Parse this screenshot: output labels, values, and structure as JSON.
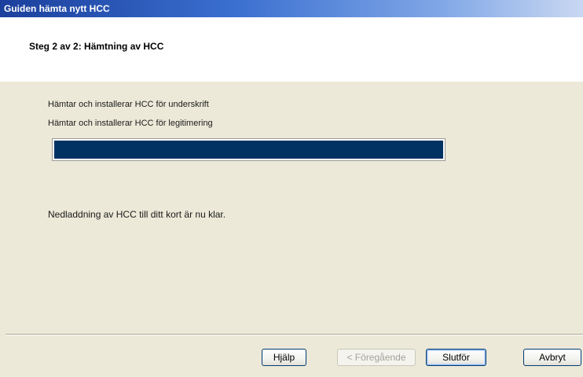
{
  "window": {
    "title": "Guiden hämta nytt HCC"
  },
  "header": {
    "step_title": "Steg 2 av 2: Hämtning av HCC"
  },
  "main": {
    "status_lines": [
      "Hämtar och installerar HCC för underskrift",
      "Hämtar och installerar HCC för legitimering"
    ],
    "progress_percent": 100,
    "completion_message": "Nedladdning av HCC till ditt kort är nu klar."
  },
  "buttons": {
    "help": "Hjälp",
    "back": "< Föregående",
    "finish": "Slutför",
    "cancel": "Avbryt"
  },
  "colors": {
    "progress_fill": "#003264",
    "dialog_background": "#ece9d8",
    "title_bar": "#1b3f9c"
  }
}
